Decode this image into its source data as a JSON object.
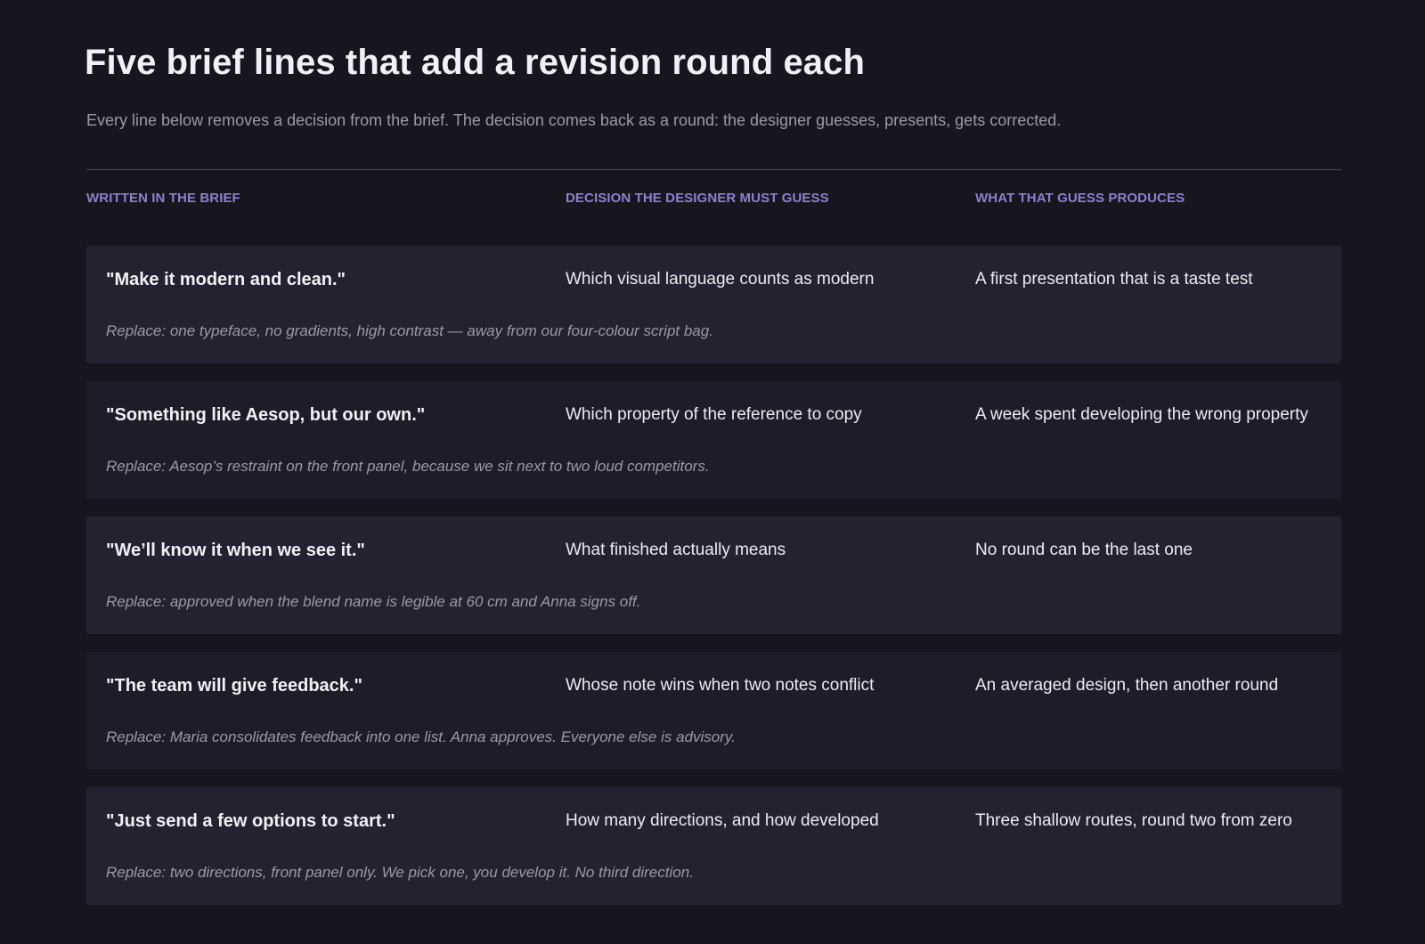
{
  "header": {
    "title": "Five brief lines that add a revision round each",
    "subtitle": "Every line below removes a decision from the brief. The decision comes back as a round: the designer guesses, presents, gets corrected."
  },
  "table": {
    "columns": [
      "WRITTEN IN THE BRIEF",
      "DECISION THE DESIGNER MUST GUESS",
      "WHAT THAT GUESS PRODUCES"
    ],
    "rows": [
      {
        "quote": "\"Make it modern and clean.\"",
        "guess": "Which visual language counts as modern",
        "produces": "A first presentation that is a taste test",
        "replace": "Replace: one typeface, no gradients, high contrast — away from our four-colour script bag."
      },
      {
        "quote": "\"Something like Aesop, but our own.\"",
        "guess": "Which property of the reference to copy",
        "produces": "A week spent developing the wrong property",
        "replace": "Replace: Aesop’s restraint on the front panel, because we sit next to two loud competitors."
      },
      {
        "quote": "\"We’ll know it when we see it.\"",
        "guess": "What finished actually means",
        "produces": "No round can be the last one",
        "replace": "Replace: approved when the blend name is legible at 60 cm and Anna signs off."
      },
      {
        "quote": "\"The team will give feedback.\"",
        "guess": "Whose note wins when two notes conflict",
        "produces": "An averaged design, then another round",
        "replace": "Replace: Maria consolidates feedback into one list. Anna approves. Everyone else is advisory."
      },
      {
        "quote": "\"Just send a few options to start.\"",
        "guess": "How many directions, and how developed",
        "produces": "Three shallow routes, round two from zero",
        "replace": "Replace: two directions, front panel only. We pick one, you develop it. No third direction."
      }
    ]
  }
}
